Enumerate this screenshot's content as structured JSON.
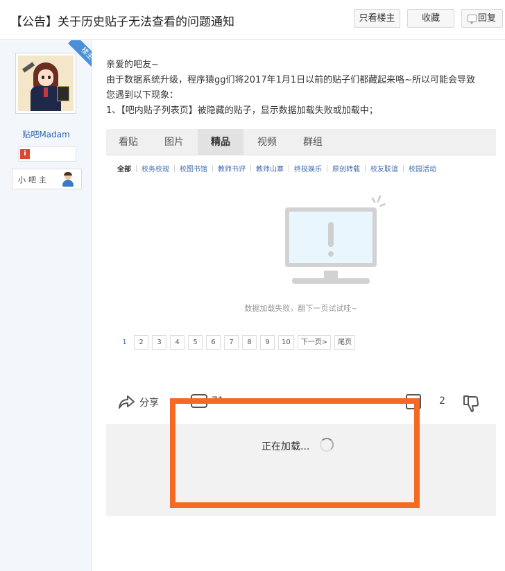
{
  "header": {
    "title": "【公告】关于历史贴子无法查看的问题通知",
    "only_op_label": "只看楼主",
    "favorite_label": "收藏",
    "reply_label": "回复",
    "reply_icon": "comment-icon"
  },
  "author": {
    "badge": "楼主",
    "username": "贴吧Madam",
    "info_icon_glyph": "i",
    "role": "小吧主"
  },
  "post": {
    "lines": [
      "亲爱的吧友~",
      "由于数据系统升级，程序猿gg们将2017年1月1日以前的贴子们都藏起来咯~所以可能会导致",
      "您遇到以下现象：",
      "1、【吧内贴子列表页】被隐藏的贴子，显示数据加载失败或加载中；"
    ]
  },
  "screenshot": {
    "tabs": [
      "看贴",
      "图片",
      "精品",
      "视频",
      "群组"
    ],
    "active_tab": "精品",
    "categories": [
      "全部",
      "校务校规",
      "校图书馆",
      "教师书评",
      "教师山寨",
      "终极娱乐",
      "原创转载",
      "校友联谊",
      "校园活动"
    ],
    "fail_message": "数据加载失败，翻下一页试试哇~",
    "pages": [
      "1",
      "2",
      "3",
      "4",
      "5",
      "6",
      "7",
      "8",
      "9",
      "10"
    ],
    "current_page": "1",
    "next_label": "下一页>",
    "last_label": "尾页",
    "share_label": "分享",
    "comment_count": "71",
    "like_count": "2",
    "loading_text": "正在加载...",
    "highlight_color": "#f46a25"
  }
}
